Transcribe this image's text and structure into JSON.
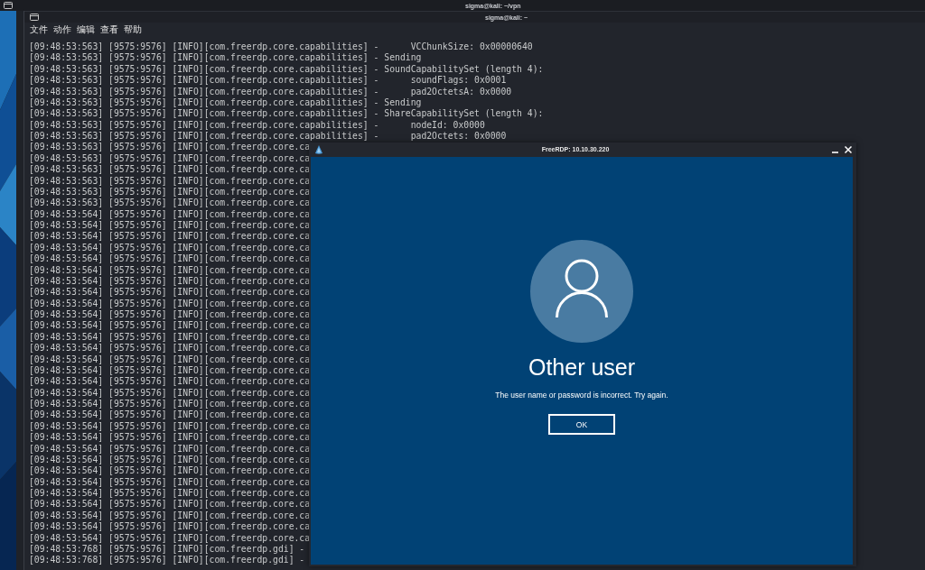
{
  "background_window": {
    "title": "sigma@kali: ~/vpn"
  },
  "terminal": {
    "title": "sigma@kali: ~",
    "menu": [
      "文件",
      "动作",
      "编辑",
      "查看",
      "帮助"
    ],
    "lines": [
      "[09:48:53:563] [9575:9576] [INFO][com.freerdp.core.capabilities] -      VCChunkSize: 0x00000640",
      "[09:48:53:563] [9575:9576] [INFO][com.freerdp.core.capabilities] - Sending",
      "[09:48:53:563] [9575:9576] [INFO][com.freerdp.core.capabilities] - SoundCapabilitySet (length 4):",
      "[09:48:53:563] [9575:9576] [INFO][com.freerdp.core.capabilities] -      soundFlags: 0x0001",
      "[09:48:53:563] [9575:9576] [INFO][com.freerdp.core.capabilities] -      pad2OctetsA: 0x0000",
      "[09:48:53:563] [9575:9576] [INFO][com.freerdp.core.capabilities] - Sending",
      "[09:48:53:563] [9575:9576] [INFO][com.freerdp.core.capabilities] - ShareCapabilitySet (length 4):",
      "[09:48:53:563] [9575:9576] [INFO][com.freerdp.core.capabilities] -      nodeId: 0x0000",
      "[09:48:53:563] [9575:9576] [INFO][com.freerdp.core.capabilities] -      pad2Octets: 0x0000",
      "[09:48:53:563] [9575:9576] [INFO][com.freerdp.core.ca",
      "[09:48:53:563] [9575:9576] [INFO][com.freerdp.core.ca",
      "[09:48:53:563] [9575:9576] [INFO][com.freerdp.core.ca",
      "[09:48:53:563] [9575:9576] [INFO][com.freerdp.core.ca",
      "[09:48:53:563] [9575:9576] [INFO][com.freerdp.core.ca",
      "[09:48:53:563] [9575:9576] [INFO][com.freerdp.core.ca",
      "[09:48:53:564] [9575:9576] [INFO][com.freerdp.core.ca",
      "[09:48:53:564] [9575:9576] [INFO][com.freerdp.core.ca",
      "[09:48:53:564] [9575:9576] [INFO][com.freerdp.core.ca",
      "[09:48:53:564] [9575:9576] [INFO][com.freerdp.core.ca",
      "[09:48:53:564] [9575:9576] [INFO][com.freerdp.core.ca",
      "[09:48:53:564] [9575:9576] [INFO][com.freerdp.core.ca",
      "[09:48:53:564] [9575:9576] [INFO][com.freerdp.core.ca",
      "[09:48:53:564] [9575:9576] [INFO][com.freerdp.core.ca",
      "[09:48:53:564] [9575:9576] [INFO][com.freerdp.core.ca",
      "[09:48:53:564] [9575:9576] [INFO][com.freerdp.core.ca",
      "[09:48:53:564] [9575:9576] [INFO][com.freerdp.core.ca",
      "[09:48:53:564] [9575:9576] [INFO][com.freerdp.core.ca",
      "[09:48:53:564] [9575:9576] [INFO][com.freerdp.core.ca",
      "[09:48:53:564] [9575:9576] [INFO][com.freerdp.core.ca",
      "[09:48:53:564] [9575:9576] [INFO][com.freerdp.core.ca",
      "[09:48:53:564] [9575:9576] [INFO][com.freerdp.core.ca",
      "[09:48:53:564] [9575:9576] [INFO][com.freerdp.core.ca",
      "[09:48:53:564] [9575:9576] [INFO][com.freerdp.core.ca",
      "[09:48:53:564] [9575:9576] [INFO][com.freerdp.core.ca",
      "[09:48:53:564] [9575:9576] [INFO][com.freerdp.core.ca",
      "[09:48:53:564] [9575:9576] [INFO][com.freerdp.core.ca",
      "[09:48:53:564] [9575:9576] [INFO][com.freerdp.core.ca",
      "[09:48:53:564] [9575:9576] [INFO][com.freerdp.core.ca",
      "[09:48:53:564] [9575:9576] [INFO][com.freerdp.core.ca",
      "[09:48:53:564] [9575:9576] [INFO][com.freerdp.core.ca",
      "[09:48:53:564] [9575:9576] [INFO][com.freerdp.core.ca",
      "[09:48:53:564] [9575:9576] [INFO][com.freerdp.core.ca",
      "[09:48:53:564] [9575:9576] [INFO][com.freerdp.core.ca",
      "[09:48:53:564] [9575:9576] [INFO][com.freerdp.core.ca",
      "[09:48:53:564] [9575:9576] [INFO][com.freerdp.core.ca",
      "[09:48:53:768] [9575:9576] [INFO][com.freerdp.gdi] -",
      "[09:48:53:768] [9575:9576] [INFO][com.freerdp.gdi] -"
    ]
  },
  "rdp_window": {
    "title": "FreeRDP: 10.10.30.220",
    "user_name": "Other user",
    "message": "The user name or password is incorrect. Try again.",
    "button": "OK"
  }
}
